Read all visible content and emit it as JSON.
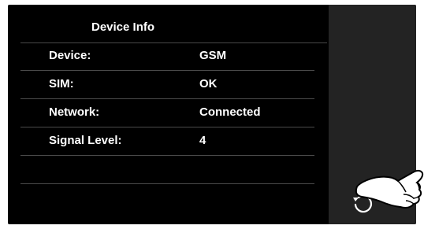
{
  "header": {
    "title": "Device Info"
  },
  "device_info": {
    "rows": [
      {
        "label": "Device:",
        "value": "GSM"
      },
      {
        "label": "SIM:",
        "value": "OK"
      },
      {
        "label": "Network:",
        "value": "Connected"
      },
      {
        "label": "Signal Level:",
        "value": "4"
      },
      {
        "label": "",
        "value": ""
      }
    ]
  },
  "icons": {
    "back": "back-arrow-icon",
    "hand": "pointing-hand-icon"
  },
  "colors": {
    "screen_bg": "#000000",
    "side_panel_bg": "#232323",
    "text": "#ffffff",
    "divider": "#4a4a4a"
  }
}
